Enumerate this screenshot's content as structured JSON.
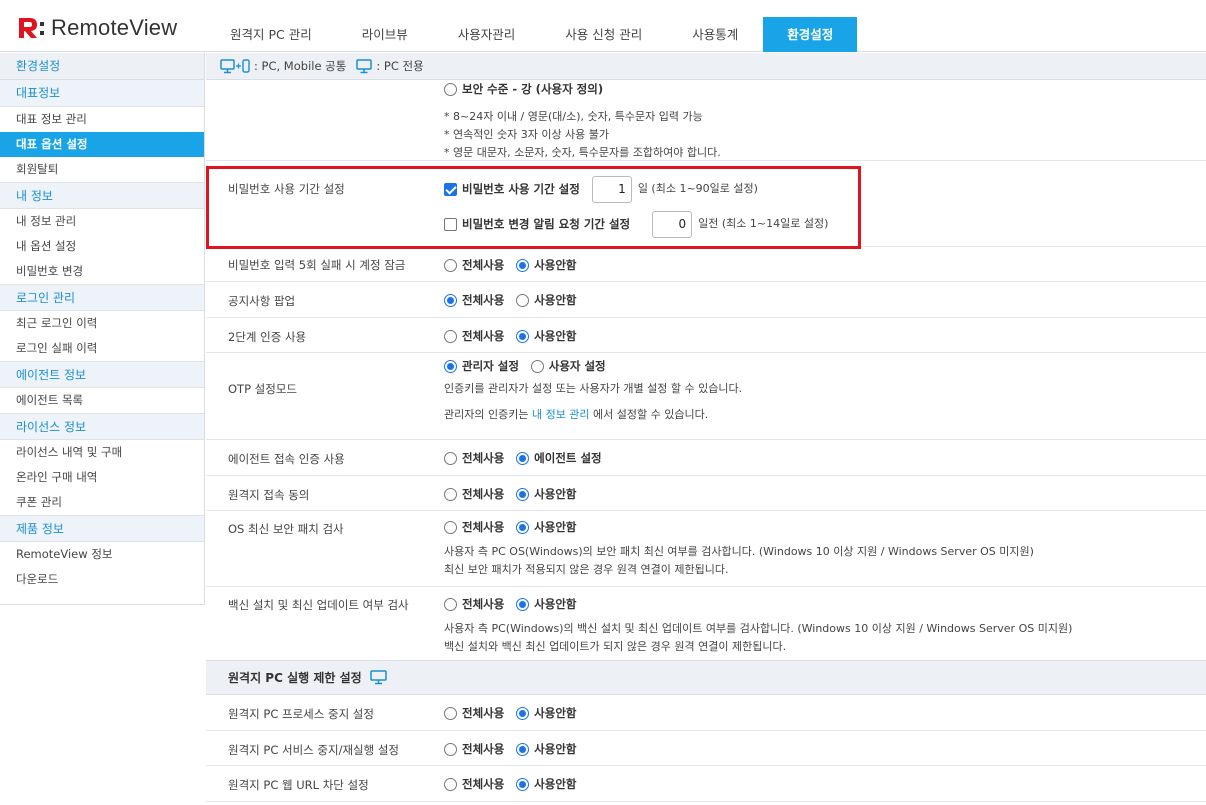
{
  "app": {
    "logo_text": "RemoteView"
  },
  "topnav": [
    {
      "label": "원격지 PC 관리",
      "active": false
    },
    {
      "label": "라이브뷰",
      "active": false
    },
    {
      "label": "사용자관리",
      "active": false
    },
    {
      "label": "사용 신청 관리",
      "active": false
    },
    {
      "label": "사용통계",
      "active": false
    },
    {
      "label": "환경설정",
      "active": true
    }
  ],
  "sidebar": {
    "head": "환경설정",
    "sections": [
      {
        "title": "대표정보",
        "items": [
          "대표 정보 관리",
          "대표 옵션 설정",
          "회원탈퇴"
        ]
      },
      {
        "title": "내 정보",
        "items": [
          "내 정보 관리",
          "내 옵션 설정",
          "비밀번호 변경"
        ]
      },
      {
        "title": "로그인 관리",
        "items": [
          "최근 로그인 이력",
          "로그인 실패 이력"
        ]
      },
      {
        "title": "에이전트 정보",
        "items": [
          "에이전트 목록"
        ]
      },
      {
        "title": "라이선스 정보",
        "items": [
          "라이선스 내역 및 구매",
          "온라인 구매 내역",
          "쿠폰 관리"
        ]
      },
      {
        "title": "제품 정보",
        "items": [
          "RemoteView 정보",
          "다운로드"
        ]
      }
    ],
    "active_item": "대표 옵션 설정"
  },
  "legend": {
    "common": ": PC, Mobile 공통",
    "pc_only": ": PC 전용"
  },
  "password_level": {
    "option": "보안 수준 - 강 (사용자 정의)",
    "notes": [
      "* 8~24자 이내 / 영문(대/소), 숫자, 특수문자 입력 가능",
      "* 연속적인 숫자 3자 이상 사용 불가",
      "* 영문 대문자, 소문자, 숫자, 특수문자를 조합하여야 합니다."
    ]
  },
  "password_period": {
    "label": "비밀번호 사용 기간 설정",
    "use_label": "비밀번호 사용 기간 설정",
    "use_value": "1",
    "use_unit": "일 (최소 1~90일로 설정)",
    "notify_label": "비밀번호 변경 알림 요청 기간 설정",
    "notify_value": "0",
    "notify_unit": "일전 (최소 1~14일로 설정)"
  },
  "rows": {
    "lock": {
      "label": "비밀번호 입력 5회 실패 시 계정 잠금",
      "opt1": "전체사용",
      "opt2": "사용안함"
    },
    "notice": {
      "label": "공지사항 팝업",
      "opt1": "전체사용",
      "opt2": "사용안함"
    },
    "twofactor": {
      "label": "2단계 인증 사용",
      "opt1": "전체사용",
      "opt2": "사용안함"
    },
    "otp": {
      "label": "OTP 설정모드",
      "opt1": "관리자 설정",
      "opt2": "사용자 설정",
      "desc1": "인증키를 관리자가 설정 또는 사용자가 개별 설정 할 수 있습니다.",
      "desc2_pre": "관리자의 인증키는 ",
      "desc2_link": "내 정보 관리",
      "desc2_post": " 에서 설정할 수 있습니다."
    },
    "agent": {
      "label": "에이전트 접속 인증 사용",
      "opt1": "전체사용",
      "opt2": "에이전트 설정"
    },
    "consent": {
      "label": "원격지 접속 동의",
      "opt1": "전체사용",
      "opt2": "사용안함"
    },
    "patch": {
      "label": "OS 최신 보안 패치 검사",
      "opt1": "전체사용",
      "opt2": "사용안함",
      "desc1": "사용자 측 PC OS(Windows)의 보안 패치 최신 여부를 검사합니다. (Windows 10 이상 지원 / Windows Server OS 미지원)",
      "desc2": "최신 보안 패치가 적용되지 않은 경우 원격 연결이 제한됩니다."
    },
    "vaccine": {
      "label": "백신 설치 및 최신 업데이트 여부 검사",
      "opt1": "전체사용",
      "opt2": "사용안함",
      "desc1": "사용자 측 PC(Windows)의 백신 설치 및 최신 업데이트 여부를 검사합니다. (Windows 10 이상 지원 / Windows Server OS 미지원)",
      "desc2": "백신 설치와 백신 최신 업데이트가 되지 않은 경우 원격 연결이 제한됩니다."
    }
  },
  "restrict_section": {
    "title": "원격지 PC 실행 제한 설정",
    "rows": [
      {
        "label": "원격지 PC 프로세스 중지 설정",
        "opt1": "전체사용",
        "opt2": "사용안함"
      },
      {
        "label": "원격지 PC 서비스 중지/재실행 설정",
        "opt1": "전체사용",
        "opt2": "사용안함"
      },
      {
        "label": "원격지 PC 웹 URL 차단 설정",
        "opt1": "전체사용",
        "opt2": "사용안함"
      }
    ]
  },
  "colors": {
    "accent": "#1aa4e8",
    "highlight_box": "#e0141e",
    "logo_red": "#e0141e"
  }
}
